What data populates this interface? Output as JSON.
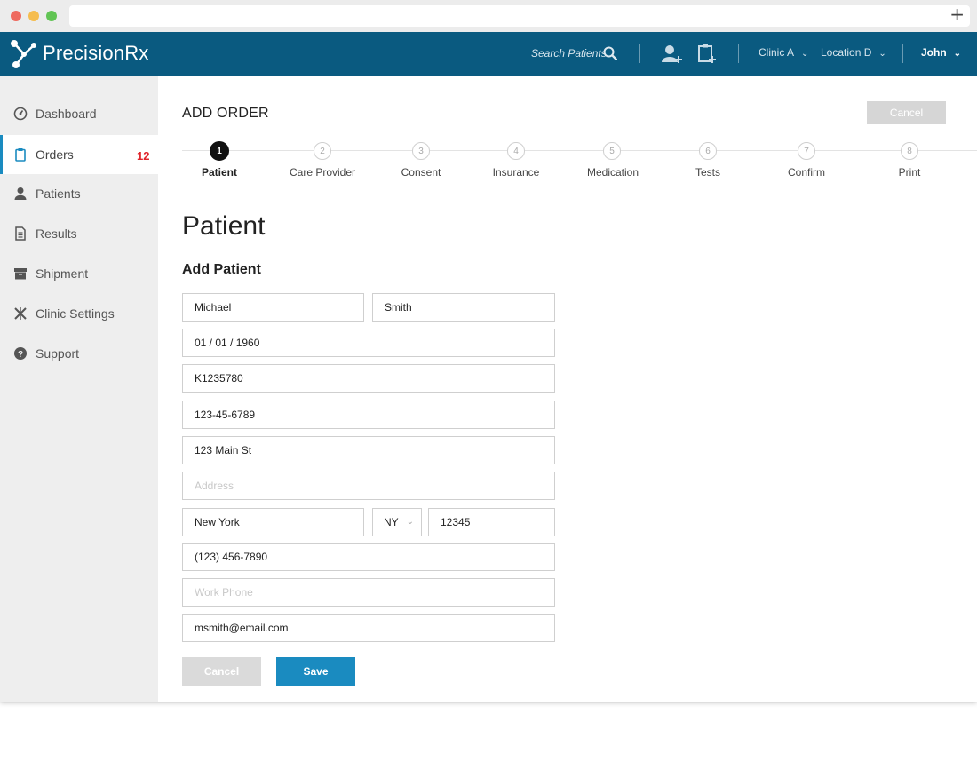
{
  "app": {
    "brand": "PrecisionRx",
    "search_placeholder": "Search Patients",
    "clinic": "Clinic A",
    "location": "Location D",
    "user": "John"
  },
  "sidebar": {
    "items": [
      {
        "label": "Dashboard",
        "icon": "dashboard-icon"
      },
      {
        "label": "Orders",
        "icon": "clipboard-icon",
        "badge": "12",
        "active": true
      },
      {
        "label": "Patients",
        "icon": "person-icon"
      },
      {
        "label": "Results",
        "icon": "document-icon"
      },
      {
        "label": "Shipment",
        "icon": "box-icon"
      },
      {
        "label": "Clinic Settings",
        "icon": "tools-icon"
      },
      {
        "label": "Support",
        "icon": "help-icon"
      }
    ]
  },
  "page": {
    "title": "ADD ORDER",
    "cancel_label": "Cancel",
    "section_title": "Patient",
    "subtitle": "Add Patient"
  },
  "steps": [
    {
      "num": "1",
      "label": "Patient",
      "active": true
    },
    {
      "num": "2",
      "label": "Care Provider"
    },
    {
      "num": "3",
      "label": "Consent"
    },
    {
      "num": "4",
      "label": "Insurance"
    },
    {
      "num": "5",
      "label": "Medication"
    },
    {
      "num": "6",
      "label": "Tests"
    },
    {
      "num": "7",
      "label": "Confirm"
    },
    {
      "num": "8",
      "label": "Print"
    }
  ],
  "form": {
    "first_name": "Michael",
    "last_name": "Smith",
    "dob": "01 / 01 / 1960",
    "id_number": "K1235780",
    "ssn": "123-45-6789",
    "address1": "123 Main St",
    "address2_placeholder": "Address",
    "city": "New York",
    "state": "NY",
    "zip": "12345",
    "phone": "(123) 456-7890",
    "work_phone_placeholder": "Work Phone",
    "email": "msmith@email.com",
    "cancel_label": "Cancel",
    "save_label": "Save"
  },
  "colors": {
    "topbar": "#0a5a80",
    "accent": "#1a8bc0",
    "badge": "#e0242b",
    "sidebar_bg": "#eeeeee",
    "disabled": "#d6d6d6"
  }
}
